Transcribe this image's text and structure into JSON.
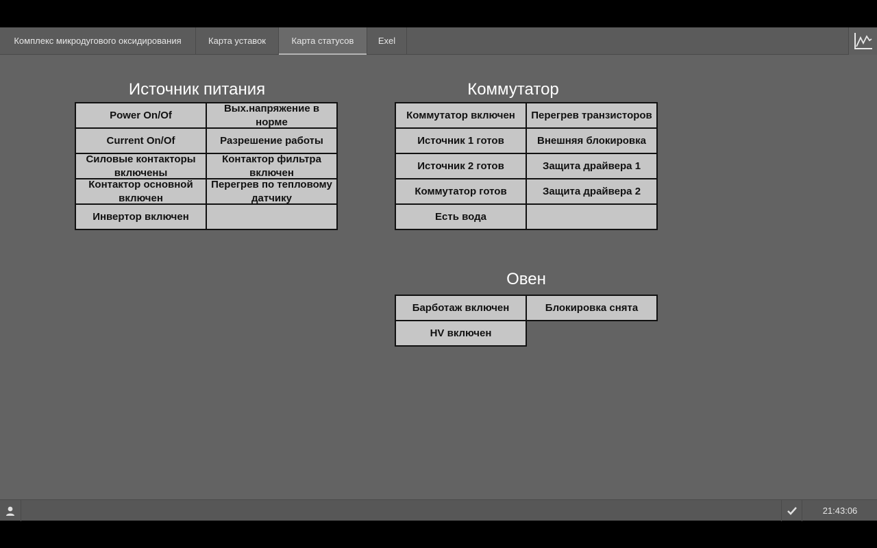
{
  "tabs": [
    {
      "label": "Комплекс микродугового оксидирования"
    },
    {
      "label": "Карта уставок"
    },
    {
      "label": "Карта статусов"
    },
    {
      "label": "Exel"
    }
  ],
  "active_tab": "Карта статусов",
  "sections": {
    "power_source": {
      "title": "Источник питания",
      "cells": [
        "Power On/Of",
        "Вых.напряжение в норме",
        "Current On/Of",
        "Разрешение работы",
        "Силовые контакторы включены",
        "Контактор фильтра включен",
        "Контактор основной включен",
        "Перегрев по тепловому датчику",
        "Инвертор включен",
        ""
      ]
    },
    "commutator": {
      "title": "Коммутатор",
      "cells": [
        "Коммутатор включен",
        "Перегрев транзисторов",
        "Источник 1 готов",
        "Внешняя блокировка",
        "Источник 2 готов",
        "Защита драйвера 1",
        "Коммутатор готов",
        "Защита драйвера 2",
        "Есть вода",
        ""
      ]
    },
    "oven": {
      "title": "Овен",
      "cells": [
        "Барботаж включен",
        "Блокировка снята",
        "HV включен"
      ]
    }
  },
  "statusbar": {
    "time": "21:43:06"
  },
  "icons": {
    "trend": "trend-chart-icon",
    "user": "user-icon",
    "acknowledge": "checkmark-icon"
  },
  "colors": {
    "background": "#636363",
    "cell": "#c6c6c6",
    "cell_border": "#111111",
    "title": "#ffffff"
  }
}
